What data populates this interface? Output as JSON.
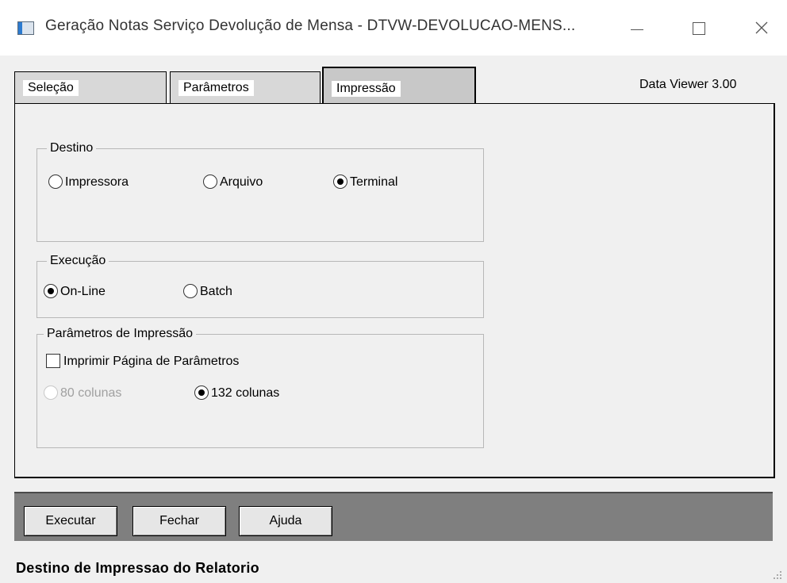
{
  "window": {
    "title": "Geração Notas Serviço Devolução de Mensa - DTVW-DEVOLUCAO-MENS...",
    "minimize": "—",
    "maximize": "☐",
    "close": "✕"
  },
  "tabs": [
    {
      "label": "Seleção"
    },
    {
      "label": "Parâmetros"
    },
    {
      "label": "Impressão",
      "active": true
    }
  ],
  "version": "Data Viewer 3.00",
  "destino": {
    "legend": "Destino",
    "options": [
      {
        "label": "Impressora",
        "selected": false
      },
      {
        "label": "Arquivo",
        "selected": false
      },
      {
        "label": "Terminal",
        "selected": true
      }
    ]
  },
  "execucao": {
    "legend": "Execução",
    "options": [
      {
        "label": "On-Line",
        "selected": true
      },
      {
        "label": "Batch",
        "selected": false
      }
    ]
  },
  "parametros_impressao": {
    "legend": "Parâmetros de Impressão",
    "checkbox_label": "Imprimir Página de Parâmetros",
    "checkbox_checked": false,
    "columns": [
      {
        "label": "80 colunas",
        "selected": false,
        "enabled": false
      },
      {
        "label": "132 colunas",
        "selected": true,
        "enabled": true
      }
    ]
  },
  "buttons": {
    "execute": "Executar",
    "close": "Fechar",
    "help": "Ajuda"
  },
  "status_bar": "Destino de Impressao do Relatorio"
}
